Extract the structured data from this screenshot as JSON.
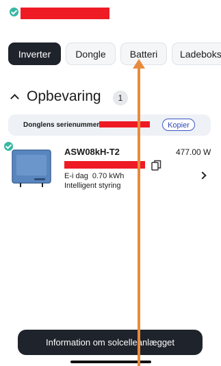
{
  "tabs": [
    "Inverter",
    "Dongle",
    "Batteri",
    "Ladeboks"
  ],
  "section": {
    "title": "Opbevaring",
    "count": "1"
  },
  "serial": {
    "label": "Donglens serienummer:",
    "copy_label": "Kopier"
  },
  "device": {
    "model": "ASW08kH-T2",
    "power": "477.00 W",
    "energy_label": "E-i dag",
    "energy_value": "0.70 kWh",
    "mode": "Intelligent styring"
  },
  "footer_button": "Information om solcelleanlægget",
  "colors": {
    "accent": "#35b8a4",
    "redaction": "#ee1b24",
    "annotation_arrow": "#e88a3c",
    "dark": "#1f232b"
  }
}
